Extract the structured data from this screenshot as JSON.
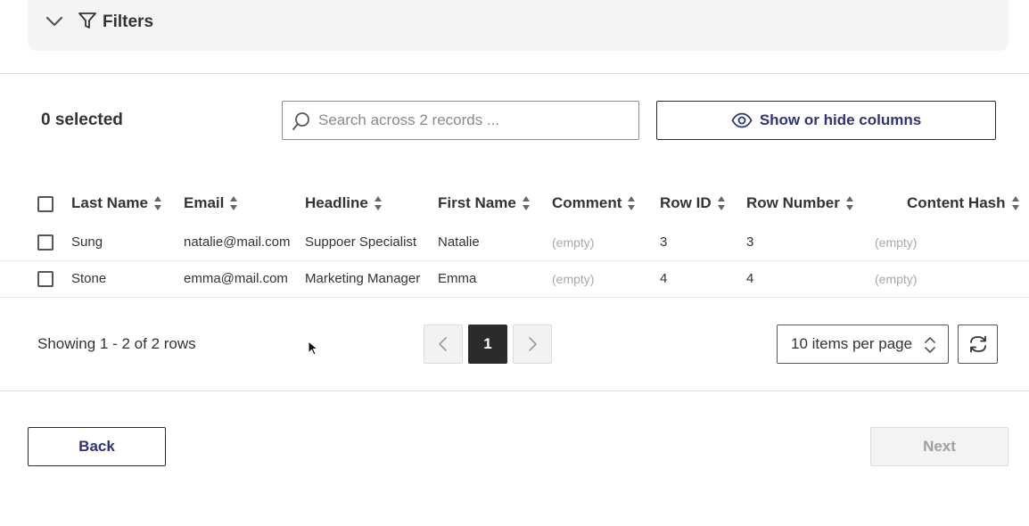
{
  "filters": {
    "label": "Filters",
    "chevron_icon": "chevron-down-icon",
    "filter_icon": "funnel-icon"
  },
  "toolbar": {
    "selected_label": "0 selected",
    "search_placeholder": "Search across 2 records ...",
    "search_value": "",
    "columns_button_label": "Show or hide columns",
    "columns_icon": "eye-icon"
  },
  "table": {
    "headers": [
      "Last Name",
      "Email",
      "Headline",
      "First Name",
      "Comment",
      "Row ID",
      "Row Number",
      "Content Hash"
    ],
    "rows": [
      {
        "last_name": "Sung",
        "email": "natalie@mail.com",
        "headline": "Suppoer Specialist",
        "first_name": "Natalie",
        "comment": "(empty)",
        "row_id": "3",
        "row_number": "3",
        "content_hash": "(empty)"
      },
      {
        "last_name": "Stone",
        "email": "emma@mail.com",
        "headline": "Marketing Manager",
        "first_name": "Emma",
        "comment": "(empty)",
        "row_id": "4",
        "row_number": "4",
        "content_hash": "(empty)"
      }
    ]
  },
  "pagination": {
    "showing_text": "Showing 1 - 2 of 2 rows",
    "current_page": "1",
    "per_page_label": "10 items per page"
  },
  "footer": {
    "back_label": "Back",
    "next_label": "Next"
  },
  "colors": {
    "accent": "#2f3278",
    "filters_bg": "#f5f4f2",
    "active_page_bg": "#2b2b2b",
    "disabled_text": "#a0a0a0"
  }
}
